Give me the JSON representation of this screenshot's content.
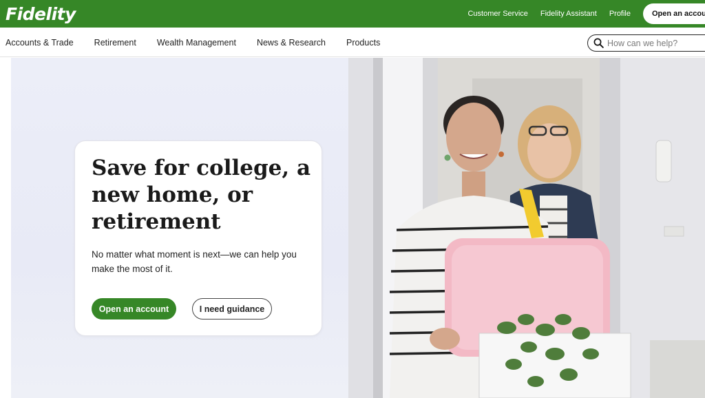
{
  "brand": {
    "logo_text": "Fidelity",
    "green": "#368727"
  },
  "top_links": {
    "customer_service": "Customer Service",
    "assistant": "Fidelity Assistant",
    "profile": "Profile",
    "open_account": "Open an account"
  },
  "nav": {
    "items": [
      "Accounts & Trade",
      "Retirement",
      "Wealth Management",
      "News & Research",
      "Products"
    ]
  },
  "search": {
    "icon": "search-icon",
    "placeholder": "How can we help?"
  },
  "hero": {
    "headline": "Save for college, a new home, or retirement",
    "subtext": "No matter what moment is next—we can help you make the most of it.",
    "primary_button": "Open an account",
    "secondary_button": "I need guidance"
  }
}
